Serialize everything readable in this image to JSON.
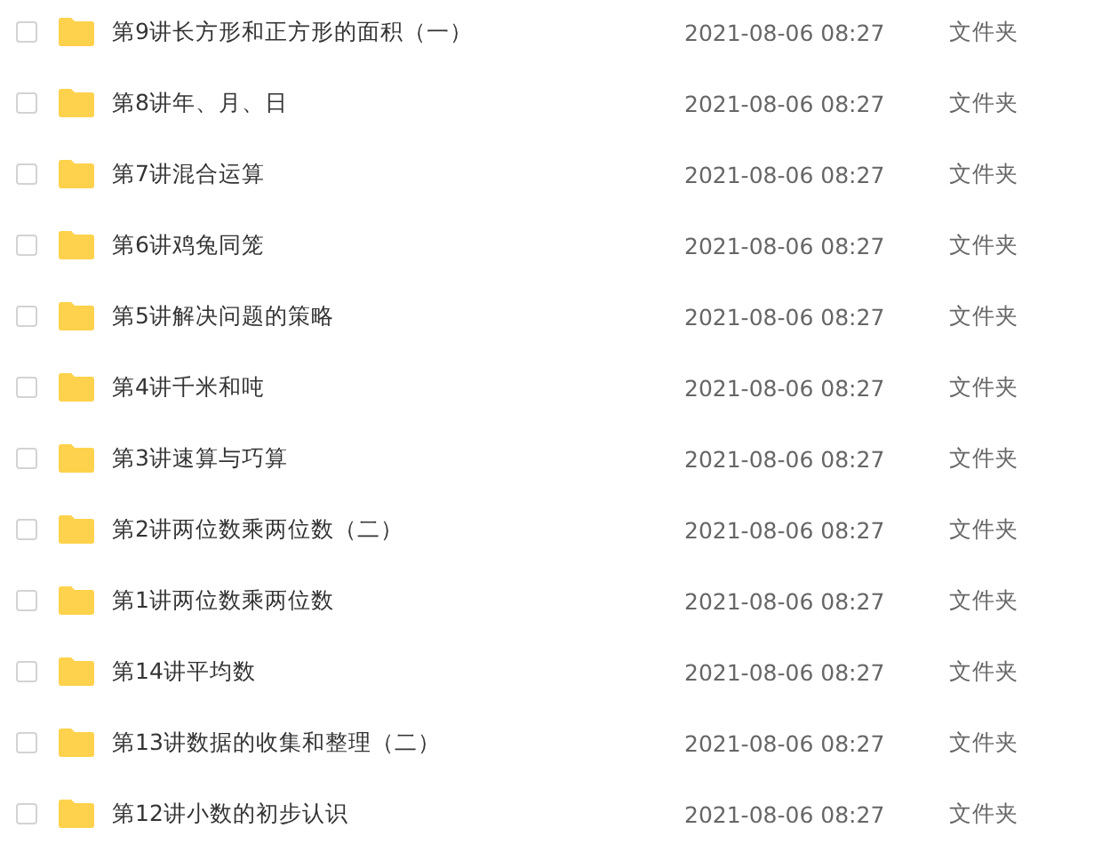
{
  "files": [
    {
      "name": "第9讲长方形和正方形的面积（一）",
      "checked": false,
      "modified": "2021-08-06 08:27",
      "type": "文件夹"
    },
    {
      "name": "第8讲年、月、日",
      "checked": false,
      "modified": "2021-08-06 08:27",
      "type": "文件夹"
    },
    {
      "name": "第7讲混合运算",
      "checked": false,
      "modified": "2021-08-06 08:27",
      "type": "文件夹"
    },
    {
      "name": "第6讲鸡兔同笼",
      "checked": false,
      "modified": "2021-08-06 08:27",
      "type": "文件夹"
    },
    {
      "name": "第5讲解决问题的策略",
      "checked": false,
      "modified": "2021-08-06 08:27",
      "type": "文件夹"
    },
    {
      "name": "第4讲千米和吨",
      "checked": false,
      "modified": "2021-08-06 08:27",
      "type": "文件夹"
    },
    {
      "name": "第3讲速算与巧算",
      "checked": false,
      "modified": "2021-08-06 08:27",
      "type": "文件夹"
    },
    {
      "name": "第2讲两位数乘两位数（二）",
      "checked": false,
      "modified": "2021-08-06 08:27",
      "type": "文件夹"
    },
    {
      "name": "第1讲两位数乘两位数",
      "checked": false,
      "modified": "2021-08-06 08:27",
      "type": "文件夹"
    },
    {
      "name": "第14讲平均数",
      "checked": false,
      "modified": "2021-08-06 08:27",
      "type": "文件夹"
    },
    {
      "name": "第13讲数据的收集和整理（二）",
      "checked": false,
      "modified": "2021-08-06 08:27",
      "type": "文件夹"
    },
    {
      "name": "第12讲小数的初步认识",
      "checked": false,
      "modified": "2021-08-06 08:27",
      "type": "文件夹"
    }
  ]
}
